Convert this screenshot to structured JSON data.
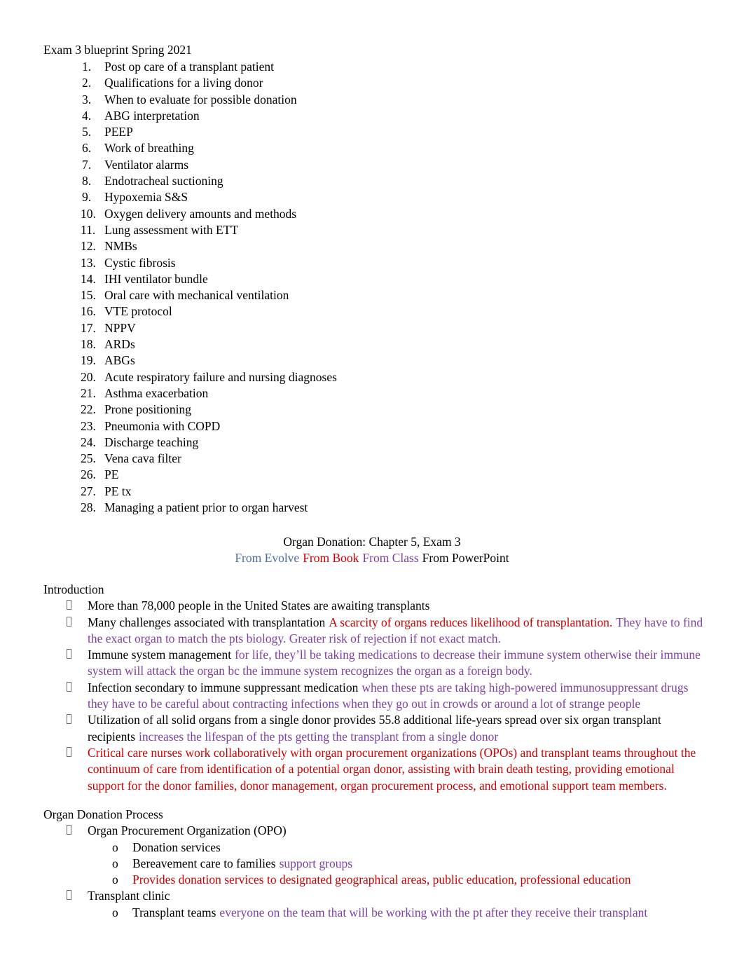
{
  "document": {
    "title": "Exam 3 blueprint Spring 2021"
  },
  "blueprint_list": [
    {
      "n": "1.",
      "text": "Post op care of a transplant patient"
    },
    {
      "n": "2.",
      "text": "Qualifications for a living donor"
    },
    {
      "n": "3.",
      "text": "When to evaluate for possible donation"
    },
    {
      "n": "4.",
      "text": "ABG interpretation"
    },
    {
      "n": "5.",
      "text": "PEEP"
    },
    {
      "n": "6.",
      "text": "Work of breathing"
    },
    {
      "n": "7.",
      "text": "Ventilator alarms"
    },
    {
      "n": "8.",
      "text": "Endotracheal suctioning"
    },
    {
      "n": "9.",
      "text": "Hypoxemia S&S"
    },
    {
      "n": "10.",
      "text": "Oxygen delivery amounts and methods"
    },
    {
      "n": "11.",
      "text": "Lung assessment with ETT"
    },
    {
      "n": "12.",
      "text": "NMBs"
    },
    {
      "n": "13.",
      "text": "Cystic fibrosis"
    },
    {
      "n": "14.",
      "text": "IHI ventilator bundle"
    },
    {
      "n": "15.",
      "text": "Oral care with mechanical ventilation"
    },
    {
      "n": "16.",
      "text": "VTE protocol"
    },
    {
      "n": "17.",
      "text": "NPPV"
    },
    {
      "n": "18.",
      "text": "ARDs"
    },
    {
      "n": "19.",
      "text": "ABGs"
    },
    {
      "n": "20.",
      "text": "Acute respiratory failure and nursing diagnoses"
    },
    {
      "n": "21.",
      "text": "Asthma exacerbation"
    },
    {
      "n": "22.",
      "text": "Prone positioning"
    },
    {
      "n": "23.",
      "text": "Pneumonia with COPD"
    },
    {
      "n": "24.",
      "text": "Discharge teaching"
    },
    {
      "n": "25.",
      "text": "Vena cava filter"
    },
    {
      "n": "26.",
      "text": "PE"
    },
    {
      "n": "27.",
      "text": "PE tx"
    },
    {
      "n": "28.",
      "text": "Managing a patient prior to organ harvest"
    }
  ],
  "chapter_header": {
    "title": "Organ Donation: Chapter 5, Exam 3",
    "legend": {
      "evolve": "From Evolve",
      "book": "From Book",
      "class": "From Class",
      "powerpoint": "From PowerPoint"
    }
  },
  "colors": {
    "evolve": "#4C6A9C",
    "book": "#CC0000",
    "class": "#7D3FA0",
    "powerpoint": "#000000"
  },
  "introduction": {
    "heading": "Introduction",
    "bullets": {
      "b1": {
        "black": "More than 78,000 people in the United States are awaiting transplants"
      },
      "b2": {
        "black": "Many challenges associated with transplantation",
        "red": "A scarcity of organs reduces likelihood of transplantation.",
        "purple": "They have to find the exact organ to match the pts biology. Greater risk of rejection if not exact match."
      },
      "b3": {
        "black": "Immune system management",
        "purple": "for life, they’ll be taking medications to decrease their immune system otherwise their immune system will attack the organ bc the immune system recognizes the organ as a foreign body."
      },
      "b4": {
        "black": "Infection secondary to immune suppressant medication",
        "purple": "when these pts are taking high-powered immunosuppressant drugs they have to be careful about contracting infections when they go out in crowds or around a lot of strange people"
      },
      "b5": {
        "black": "Utilization of all solid organs from a single donor provides 55.8 additional life-years spread over six organ transplant recipients",
        "purple": "increases the lifespan of the pts getting the transplant from a single donor"
      },
      "b6": {
        "red": "Critical care nurses work collaboratively with organ procurement organizations (OPOs) and transplant teams throughout the continuum of care from identification of a potential organ donor, assisting with brain death testing, providing emotional support for the donor families, donor management, organ procurement process, and emotional support team members."
      }
    }
  },
  "donation_process": {
    "heading": "Organ Donation Process",
    "opo": {
      "label": "Organ Procurement Organization (OPO)",
      "sub": {
        "s1": {
          "black": "Donation services"
        },
        "s2": {
          "black": "Bereavement care to families",
          "purple": "support groups"
        },
        "s3": {
          "red": "Provides donation services to designated geographical areas, public education, professional education"
        }
      }
    },
    "clinic": {
      "label": "Transplant clinic",
      "sub": {
        "s1": {
          "black": "Transplant teams",
          "purple": "everyone on the team that will be working with the pt after they receive their transplant"
        }
      }
    }
  }
}
